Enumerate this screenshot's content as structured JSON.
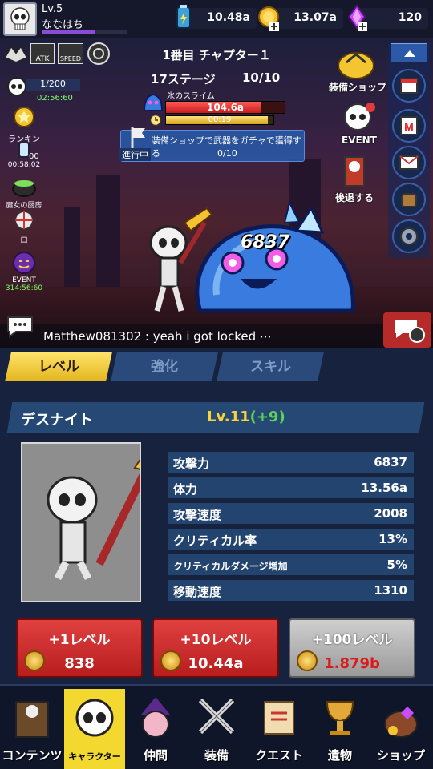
{
  "player": {
    "level": "Lv.5",
    "name": "ななはち"
  },
  "resources": {
    "battery": "10.48a",
    "gold": "13.07a",
    "gem": "120"
  },
  "stage": {
    "title": "1番目 チャプター１",
    "stage": "17ステージ",
    "progress": "10/10"
  },
  "boss": {
    "name": "氷のスライム",
    "hp": "104.6a",
    "timer": "00:19",
    "hp_fraction": 0.8,
    "timer_fraction": 0.95
  },
  "mission": {
    "status": "進行中",
    "text": "装備ショップで武器をガチャで獲得する",
    "count": "0/10"
  },
  "left_panel": {
    "buff_labels": [
      "ATK",
      "SPEED"
    ],
    "energy": "1/200",
    "energy_timer": "02:56:60",
    "ranking": "ランキング",
    "ticket_count": "00",
    "ticket_timer": "00:58:02",
    "witch": "魔女の厨房",
    "roulette": "ロ",
    "event_label": "EVENT",
    "event_timer": "314:56:60"
  },
  "right_panel": {
    "shop": "装備ショップ",
    "event": "EVENT",
    "retreat": "後退する",
    "m_label": "M"
  },
  "damage": "6837",
  "chat": {
    "text": "Matthew081302 : yeah i got locked ⋯"
  },
  "tabs": [
    "レベル",
    "強化",
    "スキル"
  ],
  "character": {
    "name": "デスナイト",
    "level": "Lv.11",
    "bonus": "(+9)"
  },
  "stats": [
    {
      "label": "攻撃力",
      "value": "6837"
    },
    {
      "label": "体力",
      "value": "13.56a"
    },
    {
      "label": "攻撃速度",
      "value": "2008"
    },
    {
      "label": "クリティカル率",
      "value": "13%"
    },
    {
      "label": "クリティカルダメージ増加",
      "value": "5%"
    },
    {
      "label": "移動速度",
      "value": "1310"
    }
  ],
  "upgrades": [
    {
      "label": "+1レベル",
      "cost": "838"
    },
    {
      "label": "+10レベル",
      "cost": "10.44a"
    },
    {
      "label": "+100レベル",
      "cost": "1.879b"
    }
  ],
  "nav": [
    "コンテンツ",
    "キャラクター",
    "仲間",
    "装備",
    "クエスト",
    "遺物",
    "ショップ"
  ],
  "colors": {
    "accent_gold": "#f3d830",
    "upgrade_red": "#d32f2f",
    "gem_purple": "#c94cff",
    "level_green": "#5dd15a"
  }
}
